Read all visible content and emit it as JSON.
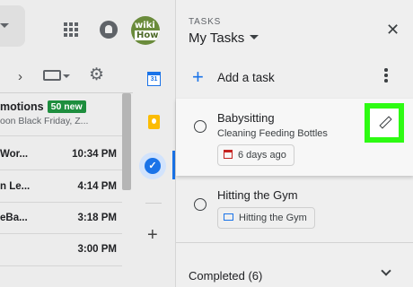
{
  "header": {
    "avatar_text_top": "wiki",
    "avatar_text_bottom": "How"
  },
  "promo": {
    "title": "motions",
    "badge": "50 new",
    "snippet": "oon Black Friday, Z..."
  },
  "mail_rows": [
    {
      "sender": "Wor...",
      "time": "10:34 PM"
    },
    {
      "sender": "n Le...",
      "time": "4:14 PM"
    },
    {
      "sender": "eBa...",
      "time": "3:18 PM"
    },
    {
      "sender": "",
      "time": "3:00 PM"
    }
  ],
  "sidestrip": {
    "calendar_day": "31"
  },
  "tasks": {
    "kicker": "TASKS",
    "title": "My Tasks",
    "add_label": "Add a task",
    "items": [
      {
        "title": "Babysitting",
        "notes": "Cleaning Feeding Bottles",
        "chip": "6 days ago"
      },
      {
        "title": "Hitting the Gym",
        "chip": "Hitting the Gym"
      }
    ],
    "completed_label": "Completed (6)"
  },
  "colors": {
    "accent": "#1a73e8",
    "badge": "#1e8e3e",
    "edit_highlight": "#2dfb12"
  },
  "icons": [
    "apps-icon",
    "bell-icon",
    "chevron-right-icon",
    "keyboard-icon",
    "gear-icon",
    "calendar-icon",
    "keep-icon",
    "tasks-icon",
    "plus-icon",
    "close-icon",
    "add-icon",
    "more-vert-icon",
    "pencil-icon",
    "event-icon",
    "mail-icon",
    "chevron-down-icon"
  ]
}
